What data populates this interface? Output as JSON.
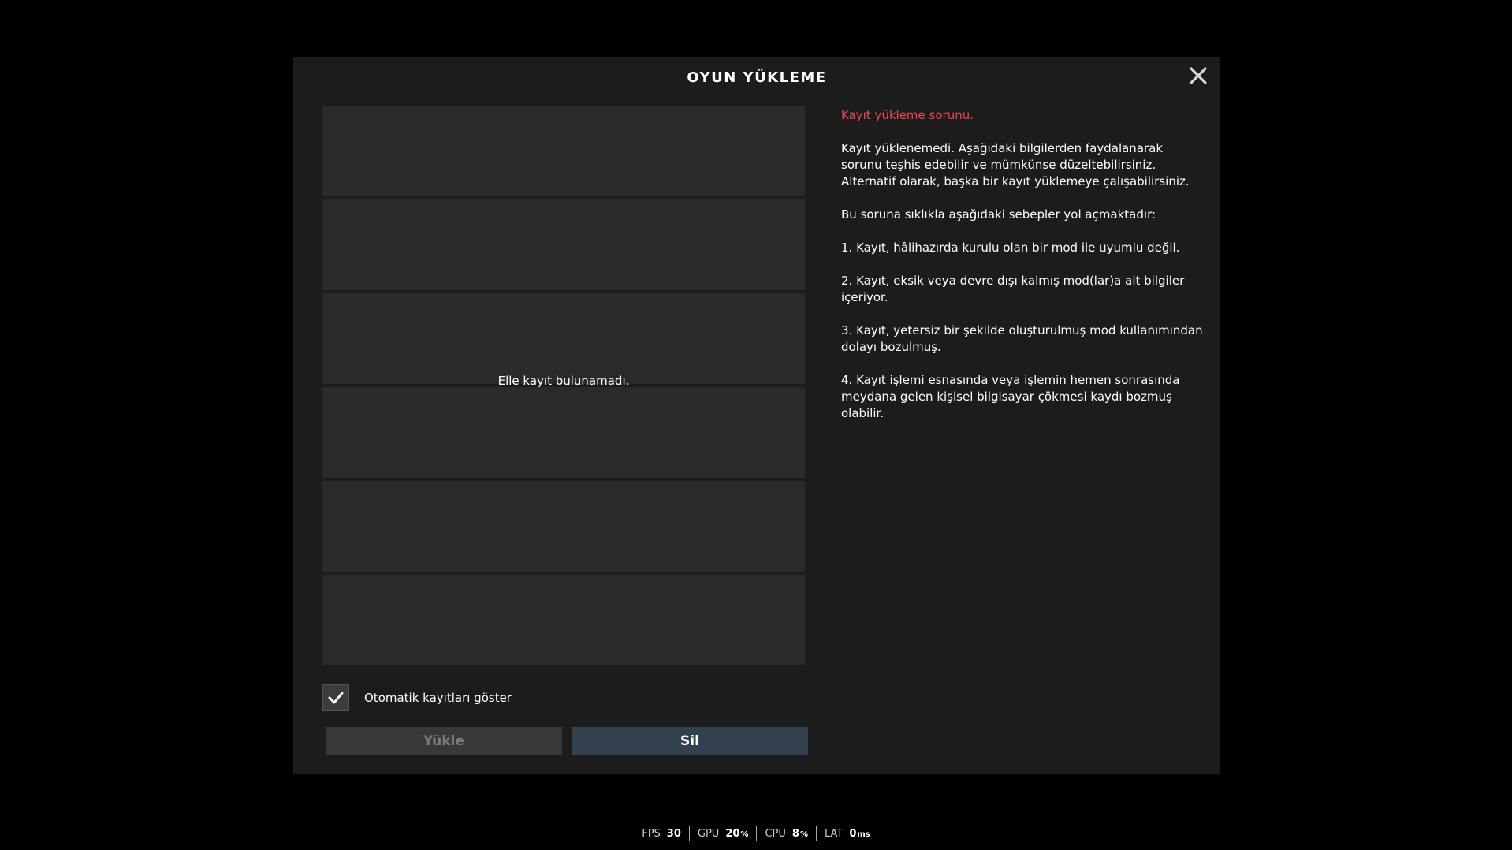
{
  "dialog": {
    "title": "OYUN YÜKLEME",
    "close_icon": "close-icon"
  },
  "save_list": {
    "empty_message": "Elle kayıt bulunamadı.",
    "slot_count": 6
  },
  "autosave": {
    "label": "Otomatik kayıtları göster",
    "checked": true
  },
  "buttons": {
    "load_label": "Yükle",
    "delete_label": "Sil"
  },
  "info": {
    "error_title": "Kayıt yükleme sorunu.",
    "paragraph_1": "Kayıt yüklenemedi. Aşağıdaki bilgilerden faydalanarak sorunu teşhis edebilir ve mümkünse düzeltebilirsiniz. Alternatif olarak, başka bir kayıt yüklemeye çalışabilirsiniz.",
    "paragraph_2": "Bu soruna sıklıkla aşağıdaki sebepler yol açmaktadır:",
    "reason_1": "1. Kayıt, hâlihazırda kurulu olan bir mod ile uyumlu değil.",
    "reason_2": "2. Kayıt, eksik veya devre dışı kalmış mod(lar)a ait bilgiler içeriyor.",
    "reason_3": "3. Kayıt, yetersiz bir şekilde oluşturulmuş mod kullanımından dolayı bozulmuş.",
    "reason_4": "4. Kayıt işlemi esnasında veya işlemin hemen sonrasında meydana gelen kişisel bilgisayar çökmesi kaydı bozmuş olabilir."
  },
  "status_bar": {
    "fps_label": "FPS",
    "fps_value": "30",
    "gpu_label": "GPU",
    "gpu_value": "20",
    "gpu_unit": "%",
    "cpu_label": "CPU",
    "cpu_value": "8",
    "cpu_unit": "%",
    "lat_label": "LAT",
    "lat_value": "0",
    "lat_unit": "ms"
  },
  "colors": {
    "dialog_bg": "#1c1c1c",
    "slot_bg": "#2a2a2a",
    "error_text": "#e8474f",
    "delete_button_bg": "#33404e",
    "load_button_bg": "#383838"
  }
}
